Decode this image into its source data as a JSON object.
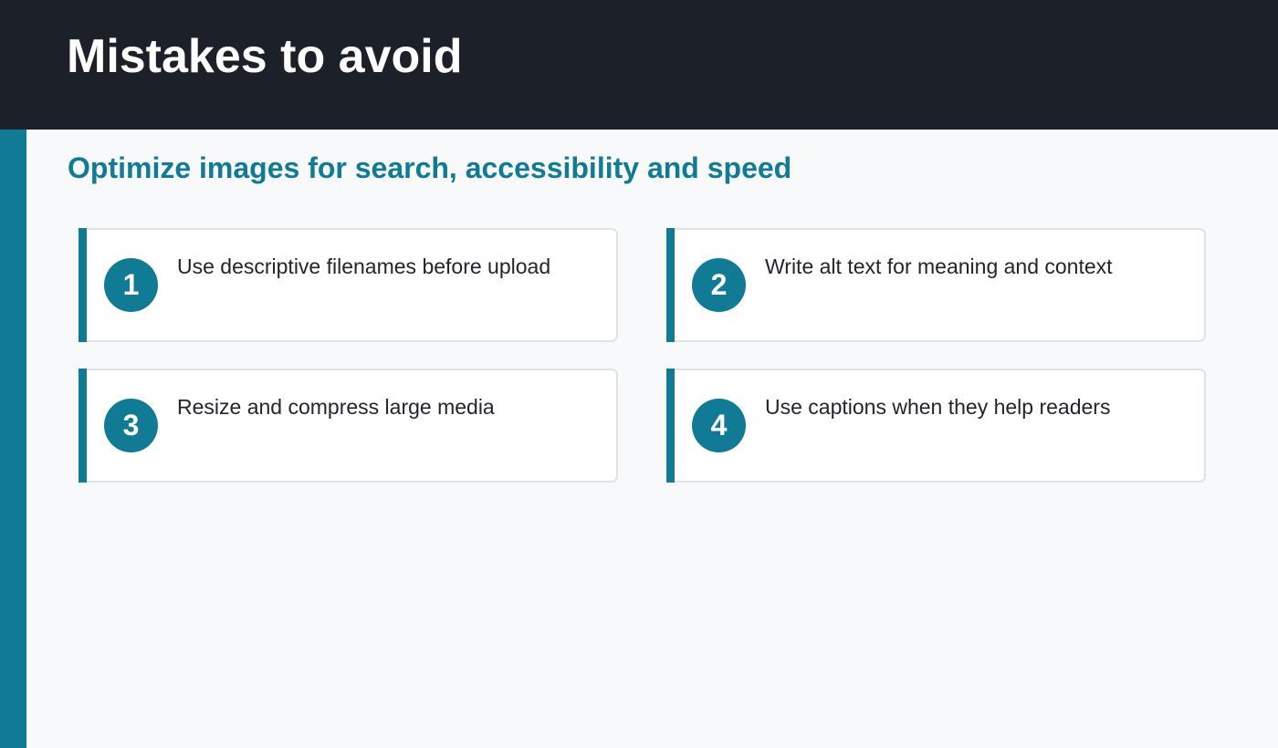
{
  "header": {
    "title": "Mistakes to avoid"
  },
  "subtitle": "Optimize images for search, accessibility and speed",
  "cards": [
    {
      "number": "1",
      "text": "Use descriptive filenames before upload"
    },
    {
      "number": "2",
      "text": "Write alt text for meaning and context"
    },
    {
      "number": "3",
      "text": "Resize and compress large media"
    },
    {
      "number": "4",
      "text": "Use captions when they help readers"
    }
  ],
  "colors": {
    "header_bg": "#1b2029",
    "accent": "#117b96",
    "background": "#f8f9fb",
    "card_bg": "#ffffff",
    "card_border": "#dfe2e6",
    "text": "#22262c"
  }
}
